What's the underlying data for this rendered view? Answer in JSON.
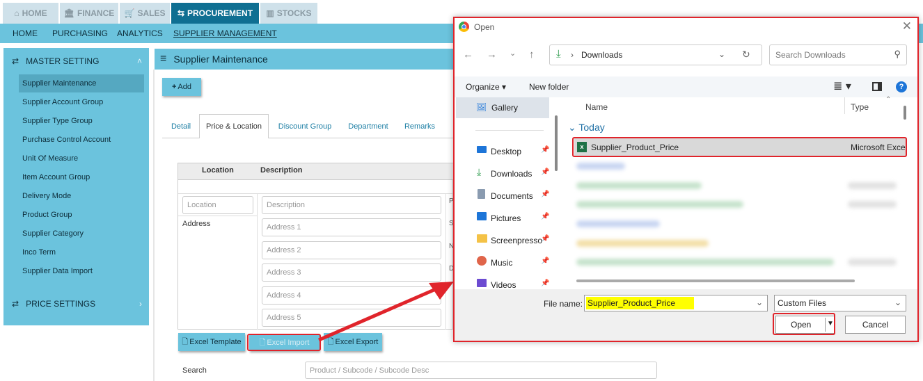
{
  "top_tabs": [
    {
      "label": "HOME",
      "icon": "home-icon"
    },
    {
      "label": "FINANCE",
      "icon": "bank-icon"
    },
    {
      "label": "SALES",
      "icon": "cart-icon"
    },
    {
      "label": "PROCUREMENT",
      "icon": "procure-icon"
    },
    {
      "label": "STOCKS",
      "icon": "chart-icon"
    }
  ],
  "sub_nav": [
    "HOME",
    "PURCHASING",
    "ANALYTICS",
    "SUPPLIER MANAGEMENT"
  ],
  "sidebar": {
    "master_setting": "MASTER SETTING",
    "items": [
      "Supplier Maintenance",
      "Supplier Account Group",
      "Supplier Type Group",
      "Purchase Control Account",
      "Unit Of Measure",
      "Item Account Group",
      "Delivery Mode",
      "Product Group",
      "Supplier Category",
      "Inco Term",
      "Supplier Data Import"
    ],
    "price_settings": "PRICE SETTINGS"
  },
  "main": {
    "title": "Supplier Maintenance",
    "add_label": "Add",
    "tabs": [
      "Detail",
      "Price & Location",
      "Discount Group",
      "Department",
      "Remarks"
    ],
    "table_headers": [
      "Location",
      "Description"
    ],
    "location_placeholder": "Location",
    "description_placeholder": "Description",
    "address_label": "Address",
    "address_placeholders": [
      "Address 1",
      "Address 2",
      "Address 3",
      "Address 4",
      "Address 5"
    ],
    "side_letters": [
      "P",
      "S",
      "N",
      "D"
    ],
    "excel_template": "Excel Template",
    "excel_import": "Excel Import",
    "excel_export": "Excel Export",
    "search_label": "Search",
    "search_placeholder": "Product / Subcode / Subcode Desc"
  },
  "dialog": {
    "title": "Open",
    "path_folder": "Downloads",
    "search_placeholder": "Search Downloads",
    "organize": "Organize",
    "new_folder": "New folder",
    "nav_items": [
      "Gallery",
      "Desktop",
      "Downloads",
      "Documents",
      "Pictures",
      "Screenpresso",
      "Music",
      "Videos"
    ],
    "col_name": "Name",
    "col_type": "Type",
    "group_today": "Today",
    "file_name": "Supplier_Product_Price",
    "file_type": "Microsoft Exce",
    "file_name_label": "File name:",
    "file_name_value": "Supplier_Product_Price",
    "file_type_filter": "Custom Files",
    "open_button": "Open",
    "cancel_button": "Cancel"
  },
  "colors": {
    "accent": "#6bc3dd",
    "active_tab": "#0f6f92",
    "highlight": "#e0242b",
    "yellow": "#ffff00"
  }
}
